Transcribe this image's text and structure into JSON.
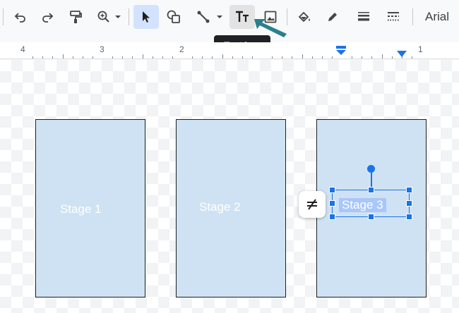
{
  "toolbar": {
    "tools": [
      {
        "name": "undo",
        "icon": "undo-icon"
      },
      {
        "name": "redo",
        "icon": "redo-icon"
      },
      {
        "name": "paint-format",
        "icon": "paint-roller-icon"
      },
      {
        "name": "zoom",
        "icon": "zoom-icon"
      },
      {
        "name": "select",
        "icon": "cursor-icon",
        "active": true
      },
      {
        "name": "shape",
        "icon": "shapes-icon"
      },
      {
        "name": "line",
        "icon": "line-icon"
      },
      {
        "name": "text-box",
        "icon": "text-box-icon",
        "hovered": true
      },
      {
        "name": "image",
        "icon": "image-icon"
      },
      {
        "name": "fill-color",
        "icon": "fill-bucket-icon"
      },
      {
        "name": "border-color",
        "icon": "pencil-icon"
      },
      {
        "name": "border-weight",
        "icon": "border-weight-icon"
      },
      {
        "name": "border-dash",
        "icon": "border-dash-icon"
      }
    ],
    "font": "Arial"
  },
  "tooltip": {
    "text": "Text box"
  },
  "ruler": {
    "labels": [
      "4",
      "3",
      "2",
      "1"
    ],
    "marker_color": "#1a73e8"
  },
  "canvas": {
    "stages": [
      {
        "label": "Stage 1"
      },
      {
        "label": "Stage 2"
      },
      {
        "label": "Stage 3",
        "selected": true
      }
    ],
    "stage_fill": "#cfe2f3",
    "selection_color": "#1a73e8"
  },
  "floating_button": {
    "icon": "strikethrough-icon"
  }
}
